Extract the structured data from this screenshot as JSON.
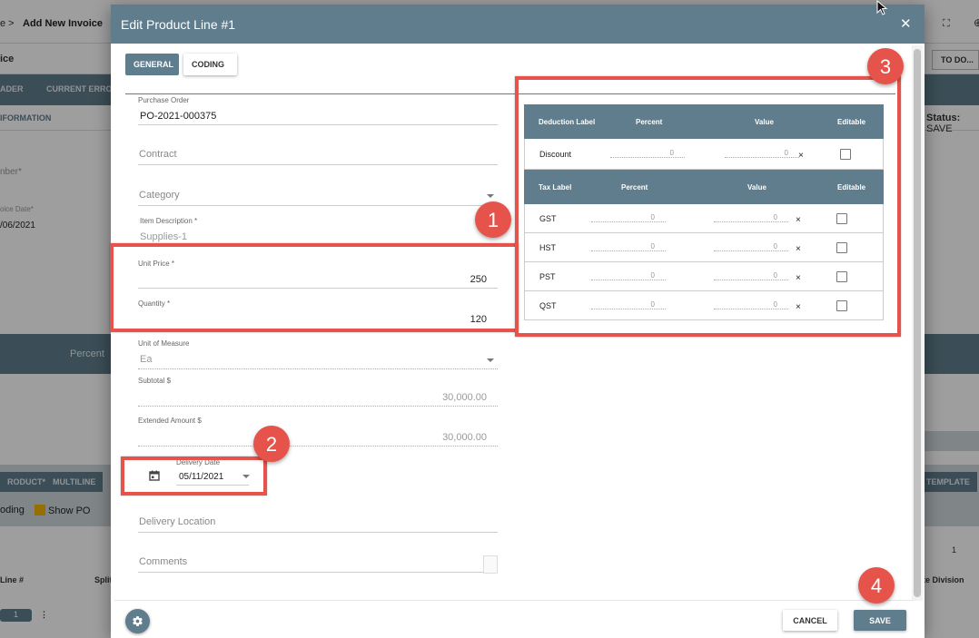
{
  "background": {
    "crumb": "e >",
    "title": "Add New Invoice",
    "sub_left": "ice",
    "todo_label": "TO DO...",
    "tabs": [
      "ADER",
      "CURRENT ERROR"
    ],
    "info_label": "IFORMATION",
    "status_label": "Status:",
    "status_value": "SAVE",
    "number_field": "nber*",
    "invoice_date_label": "oice Date*",
    "invoice_date_value": "/06/2021",
    "percent_label": "Percent",
    "product_btn": "RODUCT*",
    "multiline_btn": "MULTILINE",
    "template_btn": "TEMPLATE",
    "coding_check": "oding",
    "show_po_check": "Show PO",
    "line_header": "Line #",
    "split_header": "Split",
    "division_header": "te Division",
    "page_value": "1",
    "pill_value": "1"
  },
  "modal": {
    "title": "Edit Product Line #1",
    "close_icon": "close-icon",
    "tabs": {
      "general": "GENERAL",
      "coding": "CODING"
    },
    "fields": {
      "purchase_order_label": "Purchase Order",
      "purchase_order_value": "PO-2021-000375",
      "contract_placeholder": "Contract",
      "category_placeholder": "Category",
      "item_description_label": "Item Description *",
      "item_description_value": "Supplies-1",
      "unit_price_label": "Unit Price *",
      "unit_price_value": "250",
      "quantity_label": "Quantity *",
      "quantity_value": "120",
      "uom_label": "Unit of Measure",
      "uom_value": "Ea",
      "subtotal_label": "Subtotal $",
      "subtotal_value": "30,000.00",
      "extended_label": "Extended Amount $",
      "extended_value": "30,000.00",
      "delivery_date_label": "Delivery Date",
      "delivery_date_value": "05/11/2021",
      "delivery_location_placeholder": "Delivery Location",
      "comments_placeholder": "Comments"
    },
    "deduction_table": {
      "headers": [
        "Deduction Label",
        "Percent",
        "Value",
        "Editable"
      ],
      "rows": [
        {
          "label": "Discount",
          "percent": "0",
          "value": "0"
        }
      ]
    },
    "tax_table": {
      "headers": [
        "Tax Label",
        "Percent",
        "Value",
        "Editable"
      ],
      "rows": [
        {
          "label": "GST",
          "percent": "0",
          "value": "0"
        },
        {
          "label": "HST",
          "percent": "0",
          "value": "0"
        },
        {
          "label": "PST",
          "percent": "0",
          "value": "0"
        },
        {
          "label": "QST",
          "percent": "0",
          "value": "0"
        }
      ]
    },
    "clear_glyph": "×",
    "footer": {
      "cancel": "CANCEL",
      "save": "SAVE"
    }
  },
  "annotations": [
    "1",
    "2",
    "3",
    "4"
  ],
  "colors": {
    "header": "#5f7d8c",
    "annotation": "#e5534b"
  }
}
